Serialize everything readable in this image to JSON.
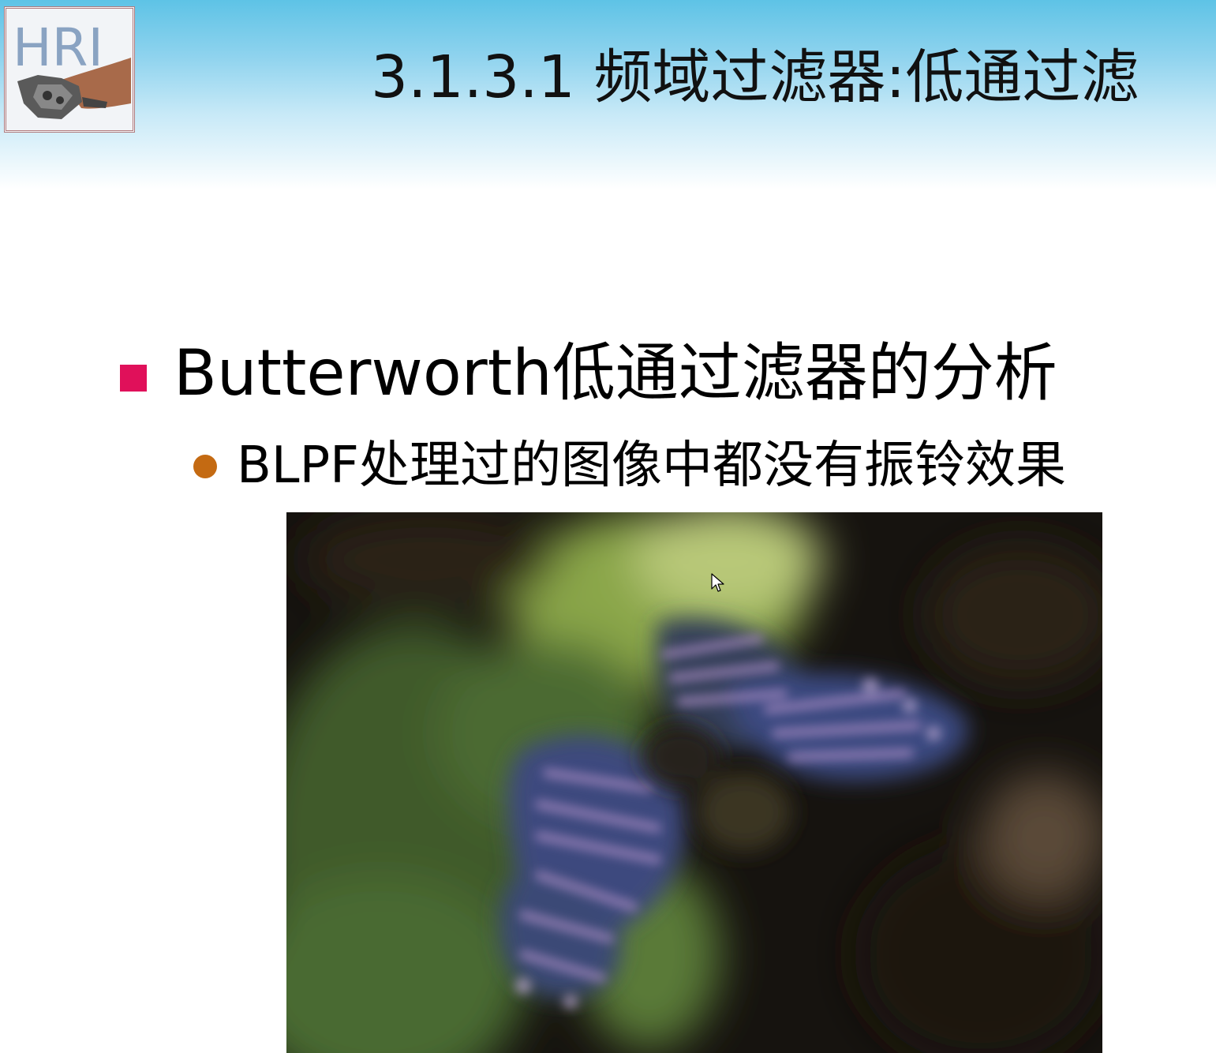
{
  "slide": {
    "title": "3.1.3.1 频域过滤器:低通过滤",
    "logo_text": "HRI",
    "bullets": [
      {
        "level": 1,
        "text": "Butterworth低通过滤器的分析"
      },
      {
        "level": 2,
        "text": "BLPF处理过的图像中都没有振铃效果"
      }
    ]
  },
  "colors": {
    "header_top": "#5ec3e6",
    "bullet_level1": "#e0105a",
    "bullet_level2": "#c46a12"
  },
  "icons": {
    "logo": "hri-logo-icon",
    "cursor": "mouse-pointer-icon"
  }
}
